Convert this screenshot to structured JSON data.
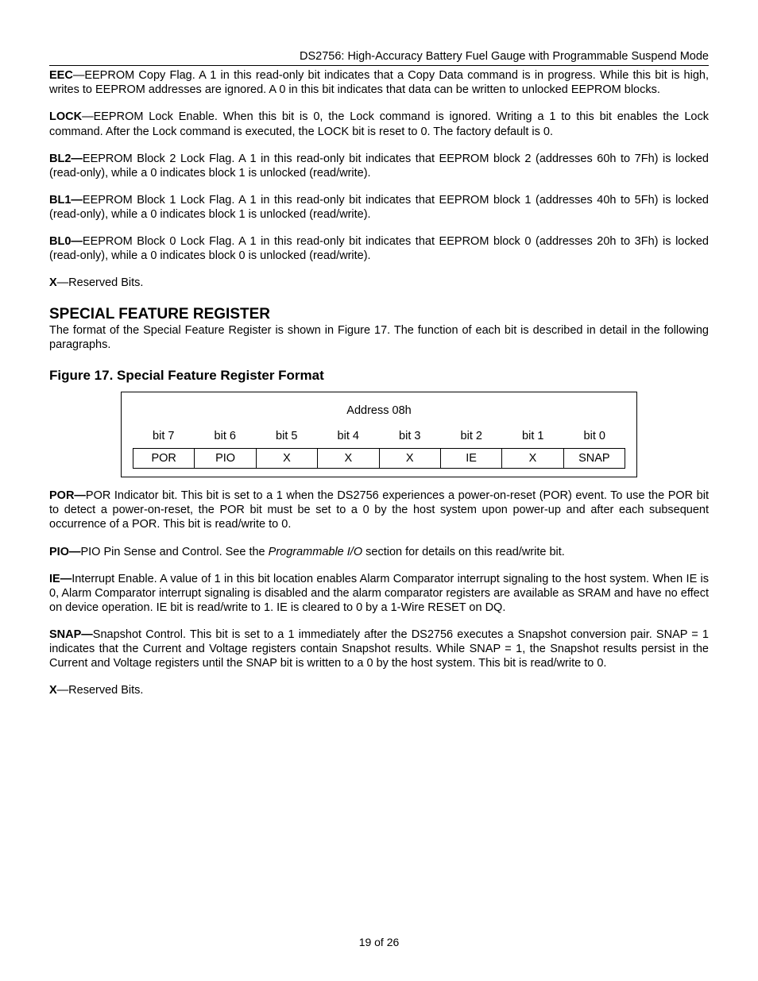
{
  "header": "DS2756: High-Accuracy Battery Fuel Gauge with Programmable Suspend Mode",
  "paragraphs": {
    "eec_label": "EEC",
    "eec_text": "—EEPROM Copy Flag. A 1 in this read-only bit indicates that a Copy Data command is in progress. While this bit is high, writes to EEPROM addresses are ignored. A 0 in this bit indicates that data can be written to unlocked EEPROM blocks.",
    "lock_label": "LOCK",
    "lock_text": "—EEPROM Lock Enable. When this bit is 0, the Lock command is ignored. Writing a 1 to this bit enables the Lock command. After the Lock command is executed, the LOCK bit is reset to 0. The factory default is 0.",
    "bl2_label": "BL2—",
    "bl2_text": "EEPROM Block 2 Lock Flag. A 1 in this read-only bit indicates that EEPROM block 2 (addresses 60h to 7Fh) is locked (read-only), while a 0 indicates block 1 is unlocked (read/write).",
    "bl1_label": "BL1—",
    "bl1_text": "EEPROM Block 1 Lock Flag. A 1 in this read-only bit indicates that EEPROM block 1 (addresses 40h to 5Fh) is locked (read-only), while a 0 indicates block 1 is unlocked (read/write).",
    "bl0_label": "BL0—",
    "bl0_text": "EEPROM Block 0 Lock Flag. A 1 in this read-only bit indicates that EEPROM block 0 (addresses 20h to 3Fh) is locked (read-only), while a 0 indicates block 0 is unlocked (read/write).",
    "x1_label": "X",
    "x1_text": "—Reserved Bits.",
    "section_heading": "SPECIAL FEATURE REGISTER",
    "section_intro": "The format of the Special Feature Register is shown in Figure 17. The function of each bit is described in detail in the following paragraphs.",
    "figure_heading": "Figure 17. Special Feature Register Format",
    "por_label": "POR—",
    "por_text": "POR Indicator bit. This bit is set to a 1 when the DS2756 experiences a power-on-reset (POR) event. To use the POR bit to detect a power-on-reset, the POR bit must be set to a 0 by the host system upon power-up and after each subsequent occurrence of a POR. This bit is read/write to 0.",
    "pio_label": "PIO—",
    "pio_text_a": "PIO Pin Sense and Control. See the ",
    "pio_em": "Programmable I/O",
    "pio_text_b": " section for details on this read/write bit.",
    "ie_label": "IE—",
    "ie_text": "Interrupt Enable. A value of 1 in this bit location enables Alarm Comparator interrupt signaling to the host system. When IE is 0, Alarm Comparator interrupt signaling is disabled and the alarm comparator registers are available as SRAM and have no effect on device operation. IE bit is read/write to 1. IE is cleared to 0 by a 1-Wire RESET on DQ.",
    "snap_label": "SNAP—",
    "snap_text": "Snapshot Control. This bit is set to a 1 immediately after the DS2756 executes a Snapshot conversion pair. SNAP = 1 indicates that the Current and Voltage registers contain Snapshot results. While SNAP = 1, the Snapshot results persist in the Current and Voltage registers until the SNAP bit is written to a 0 by the host system. This bit is read/write to 0.",
    "x2_label": "X",
    "x2_text": "—Reserved Bits."
  },
  "register": {
    "address": "Address 08h",
    "bit_labels": [
      "bit 7",
      "bit 6",
      "bit 5",
      "bit 4",
      "bit 3",
      "bit 2",
      "bit 1",
      "bit 0"
    ],
    "bit_values": [
      "POR",
      "PIO",
      "X",
      "X",
      "X",
      "IE",
      "X",
      "SNAP"
    ]
  },
  "footer": "19 of 26"
}
